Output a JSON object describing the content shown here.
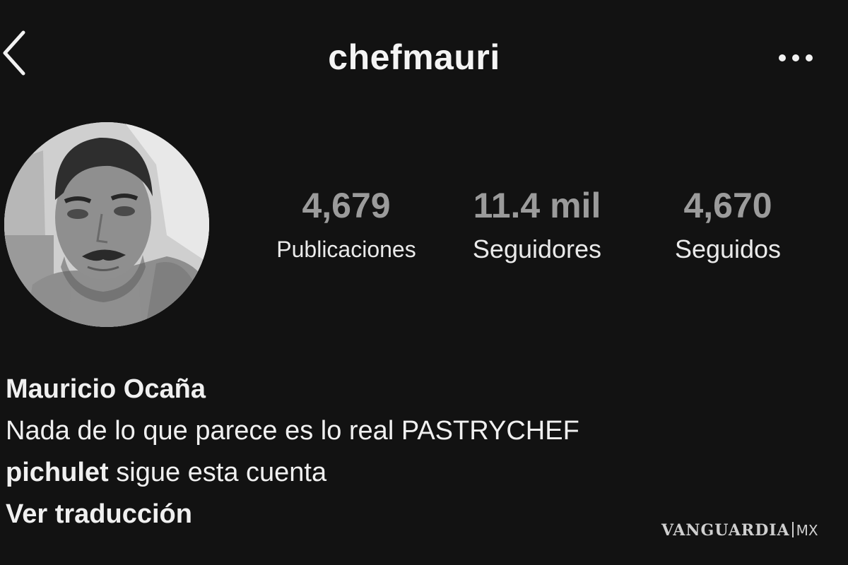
{
  "header": {
    "username": "chefmauri",
    "back_icon": "chevron-left-icon",
    "more_icon": "more-horizontal-icon"
  },
  "profile": {
    "avatar_icon": "profile-photo"
  },
  "stats": {
    "posts": {
      "value": "4,679",
      "label": "Publicaciones"
    },
    "followers": {
      "value": "11.4 mil",
      "label": "Seguidores"
    },
    "following": {
      "value": "4,670",
      "label": "Seguidos"
    }
  },
  "bio": {
    "name": "Mauricio Ocaña",
    "text": "Nada de lo que parece es lo real PASTRYCHEF",
    "followed_by_user": "pichulet",
    "followed_by_text": " sigue esta cuenta",
    "see_translation": "Ver traducción"
  },
  "watermark": {
    "brand": "VANGUARDIA",
    "country": "MX"
  },
  "colors": {
    "background": "#121212",
    "text_primary": "#f2f2f2",
    "stat_number": "#9b9b9b"
  }
}
